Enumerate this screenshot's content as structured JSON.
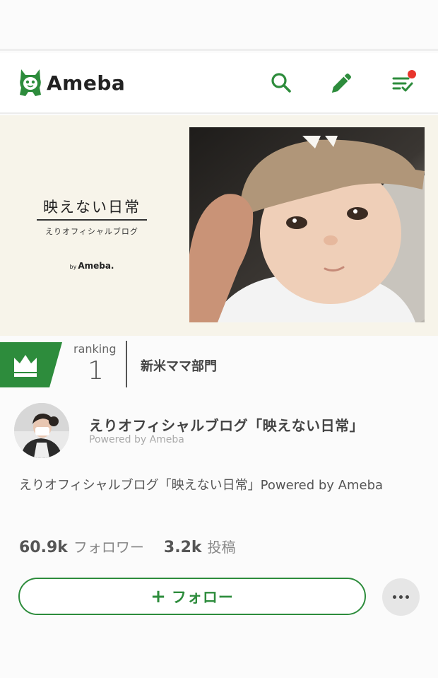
{
  "header": {
    "logo_text": "Ameba",
    "brand_color": "#2d8c3c",
    "notification_color": "#e8352c",
    "icons": [
      "search-icon",
      "edit-pencil-icon",
      "menu-check-icon"
    ]
  },
  "hero": {
    "title": "映えない日常",
    "subtitle": "えりオフィシャルブログ",
    "by_prefix": "by",
    "by_brand": "Ameba."
  },
  "ranking": {
    "label": "ranking",
    "number": "1",
    "category": "新米ママ部門",
    "icon": "crown-icon"
  },
  "profile": {
    "blog_name": "えりオフィシャルブログ「映えない日常」",
    "powered_by": "Powered by Ameba"
  },
  "description": "えりオフィシャルブログ「映えない日常」Powered by Ameba",
  "stats": {
    "followers_count": "60.9k",
    "followers_label": "フォロワー",
    "posts_count": "3.2k",
    "posts_label": "投稿"
  },
  "actions": {
    "follow_plus": "+",
    "follow_label": "フォロー",
    "more_icon": "more-horizontal-icon"
  }
}
